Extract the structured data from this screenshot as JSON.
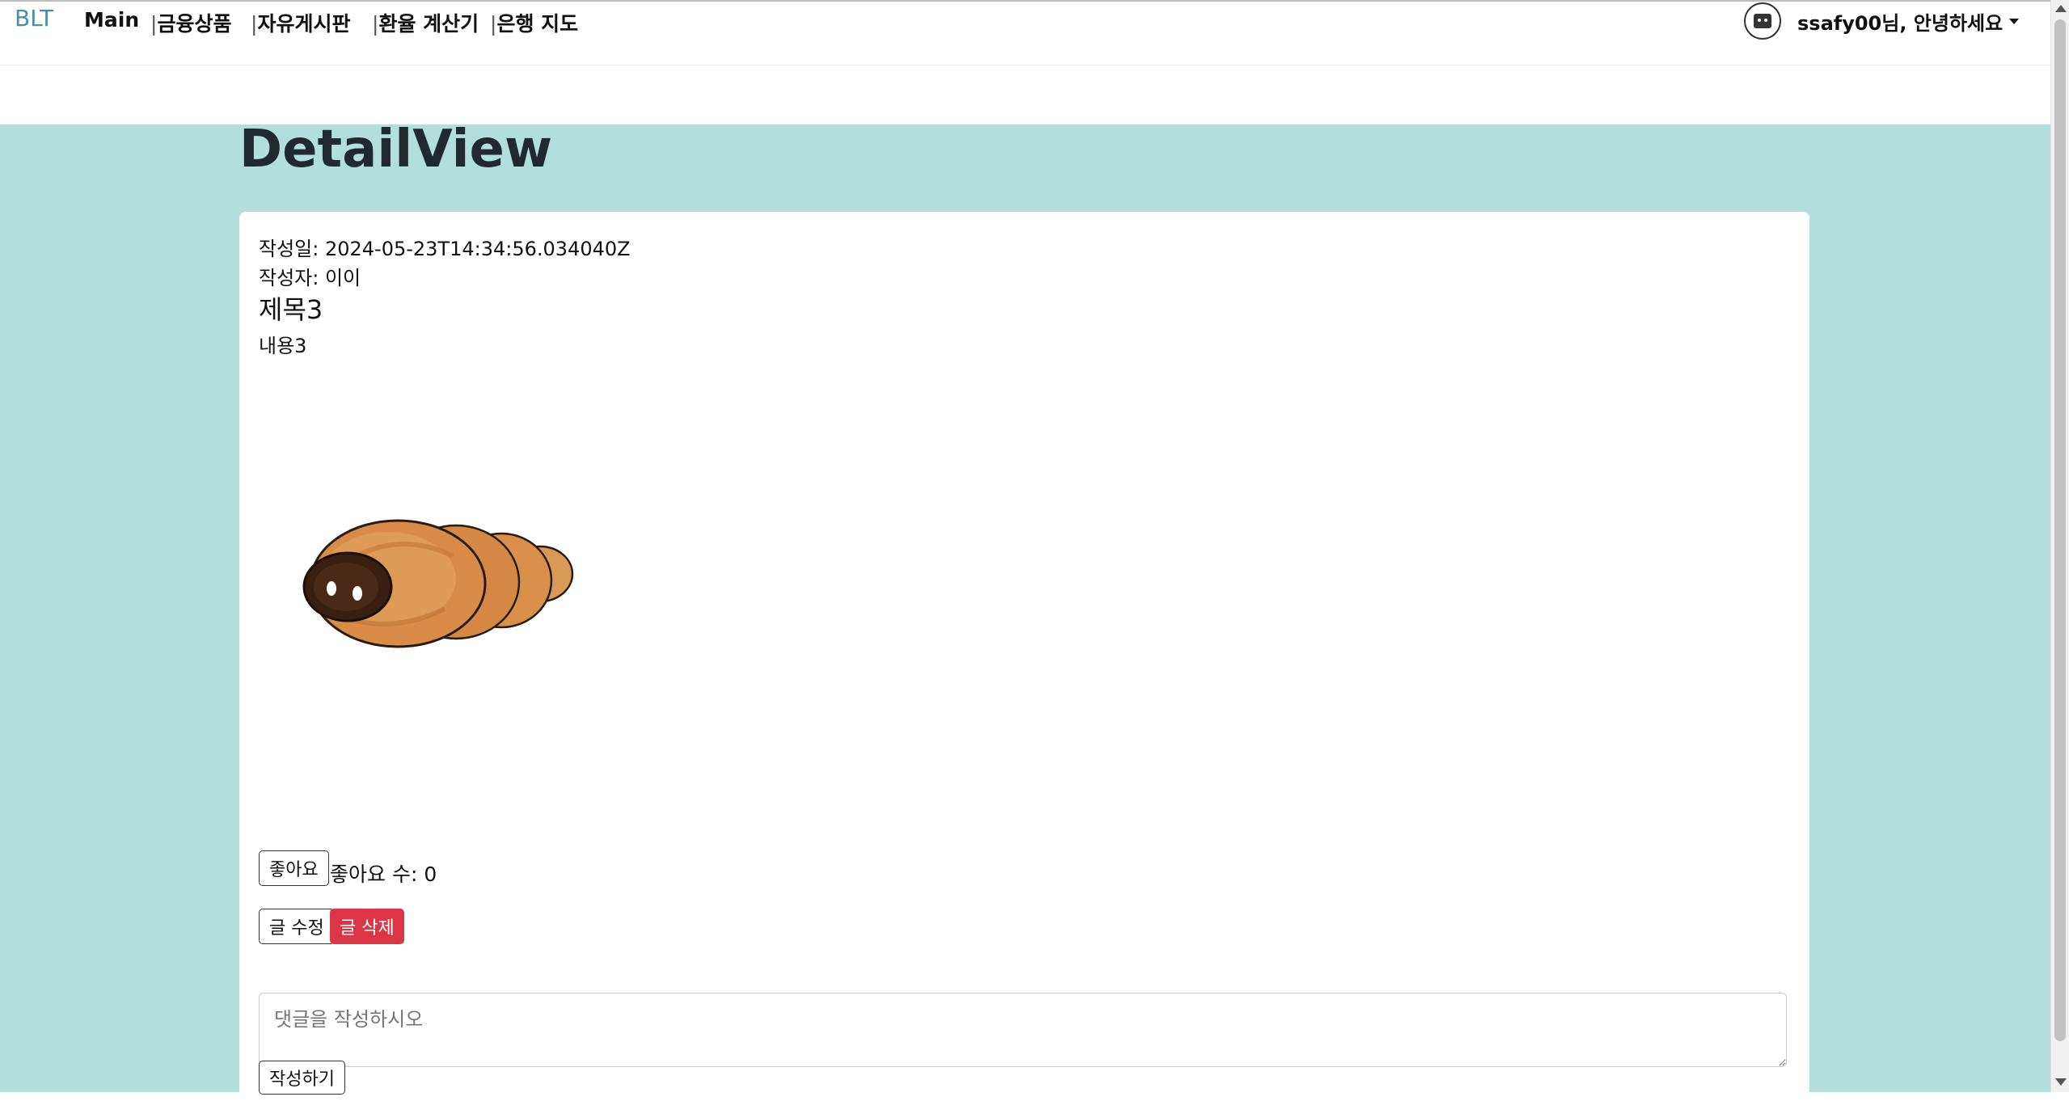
{
  "navbar": {
    "brand": "BLT",
    "links": [
      {
        "label": "Main",
        "sep": ""
      },
      {
        "label": "금융상품",
        "sep": "|"
      },
      {
        "label": "자유게시판",
        "sep": "|"
      },
      {
        "label": "환율 계산기",
        "sep": "|"
      },
      {
        "label": "은행 지도",
        "sep": "|"
      }
    ],
    "greeting": "ssafy00님, 안녕하세요"
  },
  "page": {
    "title": "DetailView"
  },
  "post": {
    "created_label": "작성일: 2024-05-23T14:34:56.034040Z",
    "author_label": "작성자: 이이",
    "title": "제목3",
    "content": "내용3",
    "image": "chocolate-cornet-bread-illustration"
  },
  "actions": {
    "like_button": "좋아요",
    "like_count": "좋아요 수: 0",
    "edit_button": "글 수정",
    "delete_button": "글 삭제"
  },
  "comment": {
    "placeholder": "댓글을 작성하시오",
    "submit_button": "작성하기"
  },
  "colors": {
    "background": "#b2dfdb",
    "danger": "#dc3545",
    "brand": "#4a90a4"
  }
}
